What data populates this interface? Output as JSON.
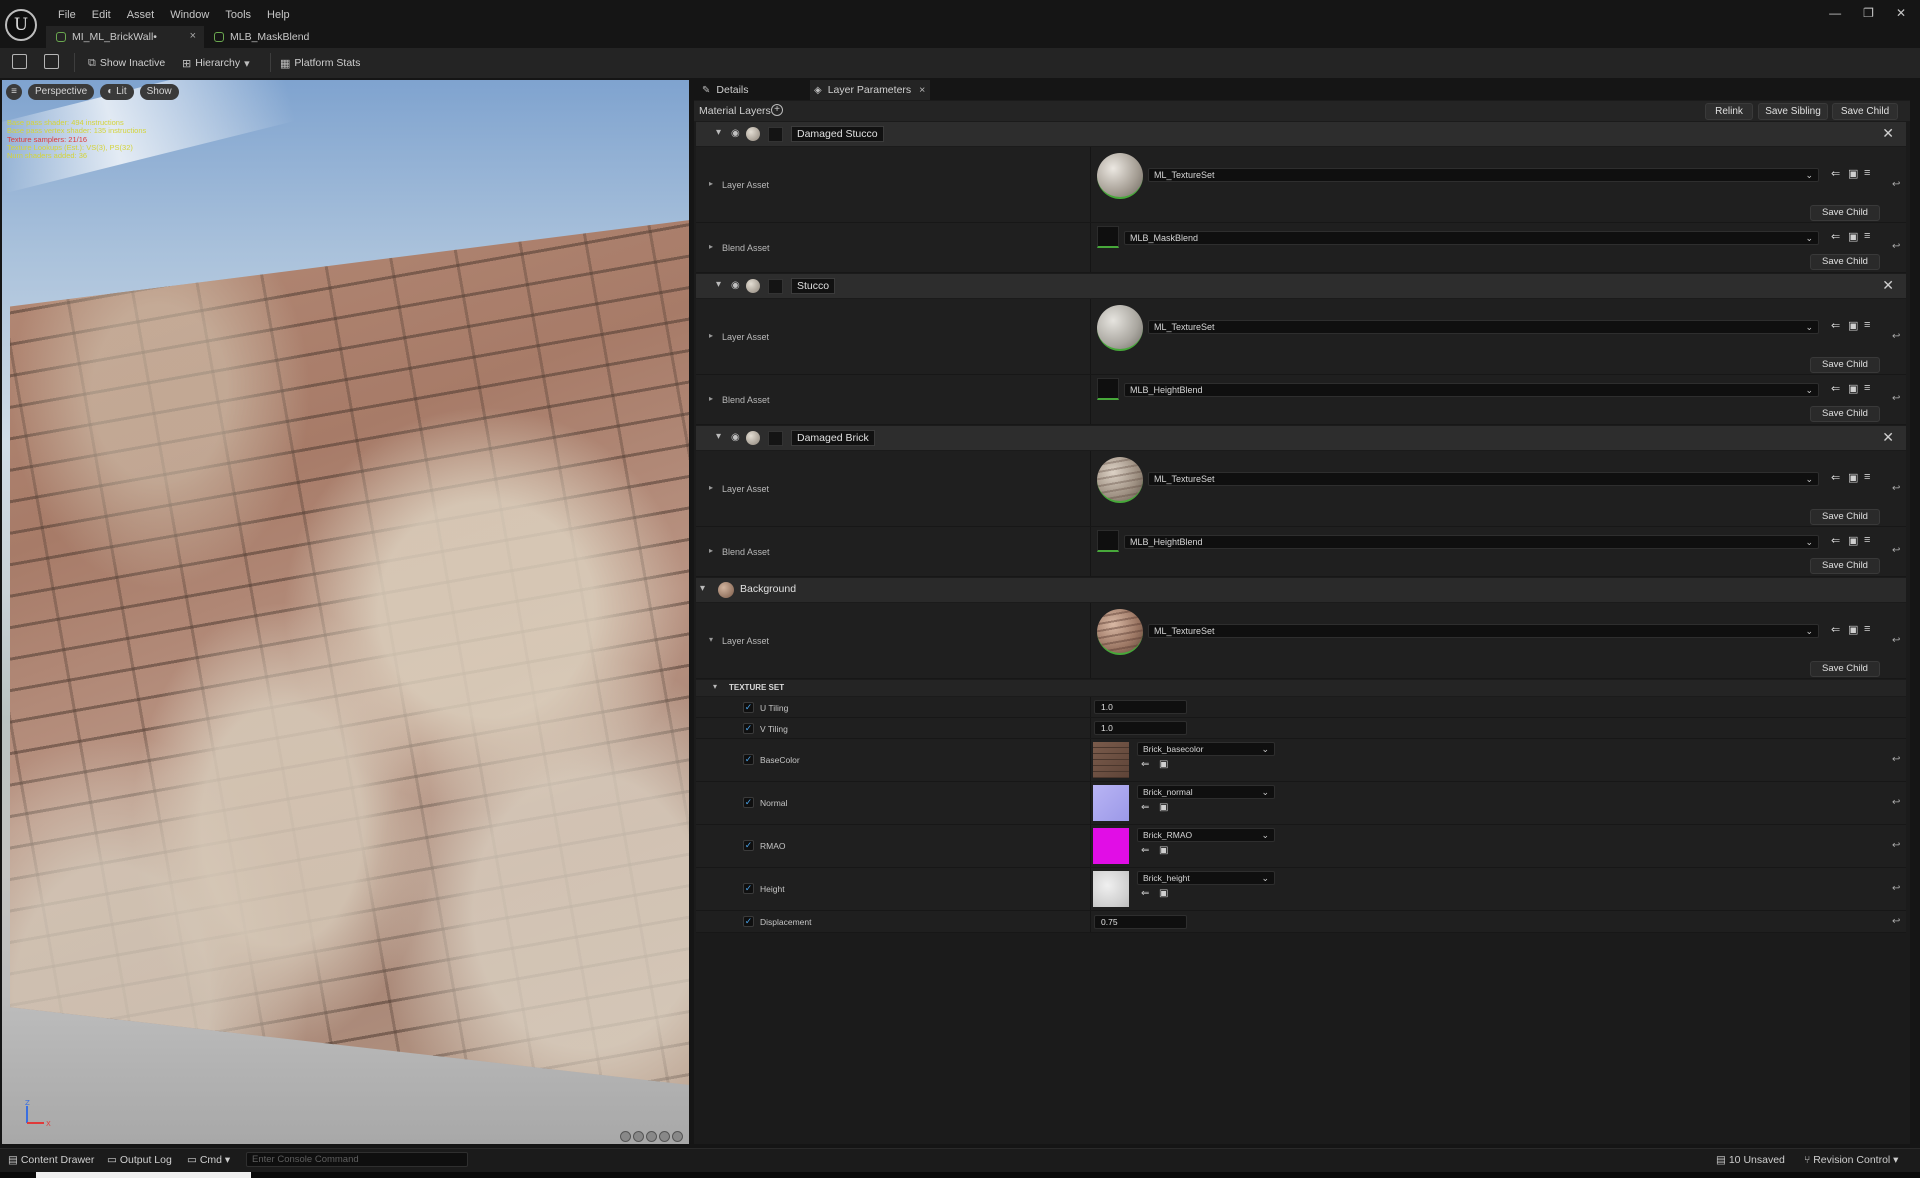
{
  "menu": [
    "File",
    "Edit",
    "Asset",
    "Window",
    "Tools",
    "Help"
  ],
  "doc_tabs": [
    {
      "label": "MI_ML_BrickWall•",
      "active": true
    },
    {
      "label": "MLB_MaskBlend",
      "active": false
    }
  ],
  "toolbar": {
    "show_inactive": "Show Inactive",
    "hierarchy": "Hierarchy",
    "platform_stats": "Platform Stats"
  },
  "viewport": {
    "buttons": {
      "perspective": "Perspective",
      "lit": "Lit",
      "show": "Show"
    },
    "stats": [
      {
        "text": "Base pass shader: 494 instructions",
        "color": "yellow"
      },
      {
        "text": "Base pass vertex shader: 135 instructions",
        "color": "yellow"
      },
      {
        "text": "Texture samplers: 21/16",
        "color": "red"
      },
      {
        "text": "Texture Lookups (Est.): VS(3), PS(32)",
        "color": "yellow"
      },
      {
        "text": "Num shaders added: 36",
        "color": "yellow"
      }
    ],
    "axis": {
      "z": "Z",
      "x": "X"
    }
  },
  "panel_tabs": {
    "details": "Details",
    "layer_parameters": "Layer Parameters"
  },
  "material_layers": {
    "label": "Material Layers",
    "buttons": {
      "relink": "Relink",
      "save_sibling": "Save Sibling",
      "save_child": "Save Child"
    },
    "row_labels": {
      "layer_asset": "Layer Asset",
      "blend_asset": "Blend Asset",
      "save_child": "Save Child"
    },
    "layers": [
      {
        "name": "Damaged Stucco",
        "layer_asset": "ML_TextureSet",
        "blend_asset": "MLB_MaskBlend"
      },
      {
        "name": "Stucco",
        "layer_asset": "ML_TextureSet",
        "blend_asset": "MLB_HeightBlend"
      },
      {
        "name": "Damaged Brick",
        "layer_asset": "ML_TextureSet",
        "blend_asset": "MLB_HeightBlend"
      }
    ],
    "background": {
      "name": "Background",
      "layer_asset": "ML_TextureSet"
    }
  },
  "texture_set": {
    "title": "TEXTURE SET",
    "u_tiling": {
      "label": "U Tiling",
      "value": "1.0"
    },
    "v_tiling": {
      "label": "V Tiling",
      "value": "1.0"
    },
    "textures": [
      {
        "label": "BaseColor",
        "value": "Brick_basecolor",
        "color": "#6e5244"
      },
      {
        "label": "Normal",
        "value": "Brick_normal",
        "color": "#a9a6ee"
      },
      {
        "label": "RMAO",
        "value": "Brick_RMAO",
        "color": "#e10de6"
      },
      {
        "label": "Height",
        "value": "Brick_height",
        "color": "#d9d9d9"
      }
    ],
    "displacement": {
      "label": "Displacement",
      "value": "0.75"
    }
  },
  "statusbar": {
    "content_drawer": "Content Drawer",
    "output_log": "Output Log",
    "cmd": "Cmd",
    "console_placeholder": "Enter Console Command",
    "unsaved": "10 Unsaved",
    "revision_control": "Revision Control"
  }
}
